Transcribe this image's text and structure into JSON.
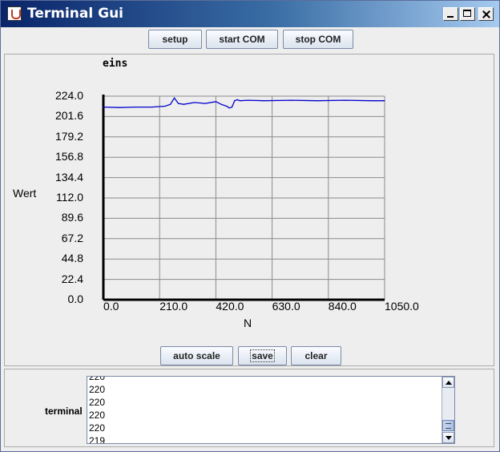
{
  "window": {
    "title": "Terminal Gui"
  },
  "toolbar": {
    "setup_label": "setup",
    "start_label": "start COM",
    "stop_label": "stop COM"
  },
  "chart_data": {
    "type": "line",
    "title": "eins",
    "xlabel": "N",
    "ylabel": "Wert",
    "xlim": [
      0,
      1050
    ],
    "ylim": [
      0,
      224
    ],
    "x_ticks": [
      "0.0",
      "210.0",
      "420.0",
      "630.0",
      "840.0",
      "1050.0"
    ],
    "y_ticks": [
      "224.0",
      "201.6",
      "179.2",
      "156.8",
      "134.4",
      "112.0",
      "89.6",
      "67.2",
      "44.8",
      "22.4",
      "0.0"
    ],
    "grid": true,
    "line_color": "#0000cc",
    "series": [
      {
        "x": [
          0,
          60,
          120,
          180,
          230,
          250,
          265,
          280,
          300,
          340,
          380,
          420,
          440,
          460,
          470,
          480,
          490,
          500,
          510,
          540,
          600,
          700,
          800,
          900,
          1000,
          1050
        ],
        "y": [
          212,
          211.5,
          212,
          212,
          213,
          215,
          222,
          216,
          215,
          217,
          216,
          218,
          215,
          213,
          211,
          212,
          219,
          220,
          219,
          219.5,
          219,
          219.5,
          219,
          219.5,
          219,
          219
        ]
      }
    ]
  },
  "controls": {
    "auto_scale_label": "auto scale",
    "save_label": "save",
    "clear_label": "clear"
  },
  "terminal": {
    "label": "terminal",
    "lines": [
      "220",
      "220",
      "220",
      "220",
      "219",
      "220"
    ]
  }
}
